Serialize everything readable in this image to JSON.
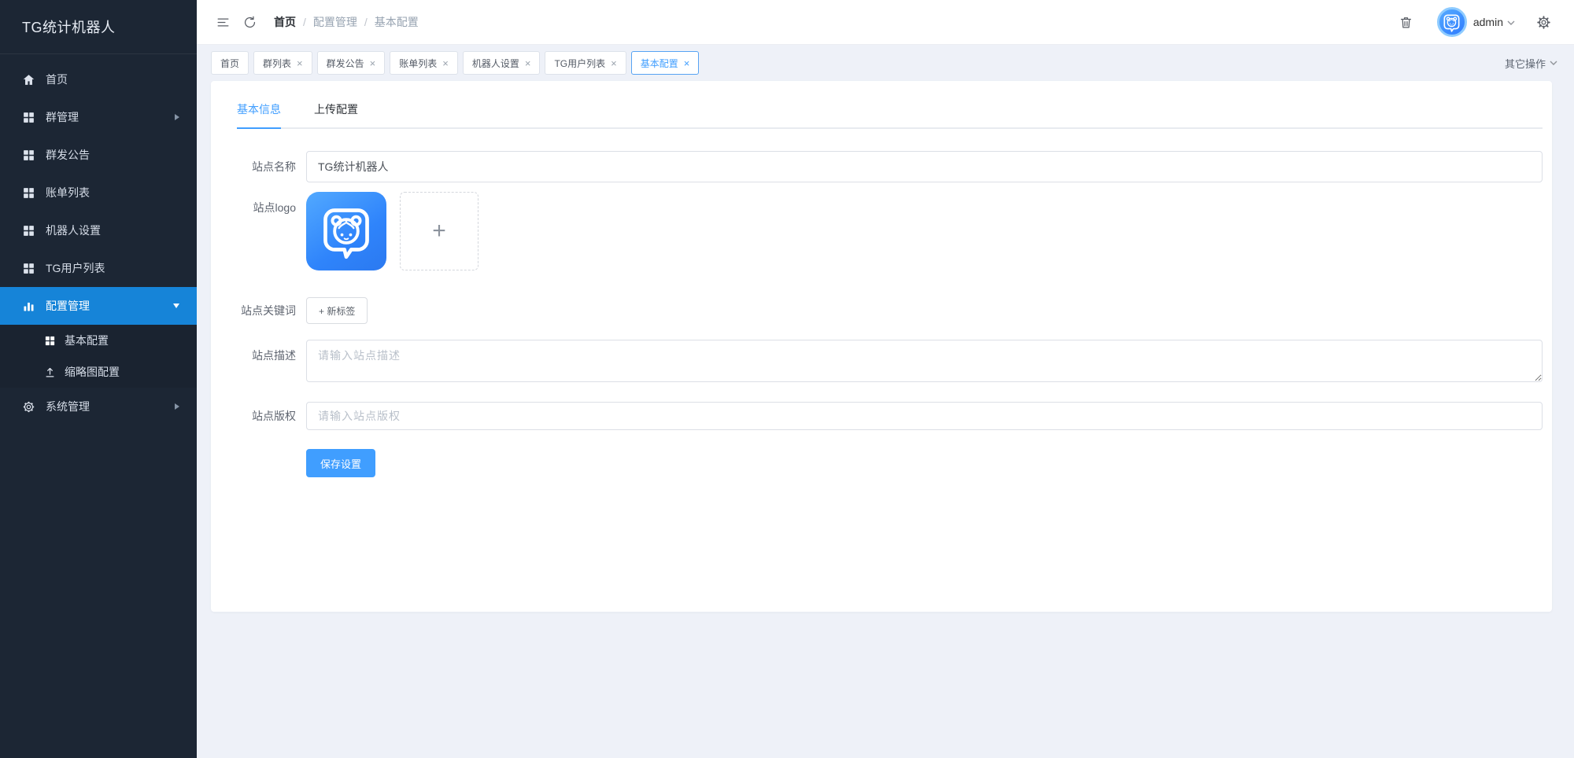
{
  "app": {
    "title": "TG统计机器人"
  },
  "glyphs": {
    "close": "×",
    "plus": "+",
    "slash": "/"
  },
  "sidebar": {
    "items": [
      {
        "label": "首页"
      },
      {
        "label": "群管理"
      },
      {
        "label": "群发公告"
      },
      {
        "label": "账单列表"
      },
      {
        "label": "机器人设置"
      },
      {
        "label": "TG用户列表"
      },
      {
        "label": "配置管理"
      },
      {
        "label": "系统管理"
      }
    ],
    "submenu": [
      {
        "label": "基本配置"
      },
      {
        "label": "缩略图配置"
      }
    ]
  },
  "header": {
    "breadcrumb": [
      "首页",
      "配置管理",
      "基本配置"
    ],
    "user": "admin"
  },
  "tagbar": {
    "tags": [
      {
        "label": "首页"
      },
      {
        "label": "群列表"
      },
      {
        "label": "群发公告"
      },
      {
        "label": "账单列表"
      },
      {
        "label": "机器人设置"
      },
      {
        "label": "TG用户列表"
      },
      {
        "label": "基本配置"
      }
    ],
    "more_label": "其它操作"
  },
  "content": {
    "tabs": [
      {
        "label": "基本信息"
      },
      {
        "label": "上传配置"
      }
    ],
    "form": {
      "site_name": {
        "label": "站点名称",
        "value": "TG统计机器人"
      },
      "site_logo": {
        "label": "站点logo"
      },
      "site_keywords": {
        "label": "站点关键词",
        "new_tag_label": "+ 新标签"
      },
      "site_desc": {
        "label": "站点描述",
        "placeholder": "请输入站点描述"
      },
      "site_copyright": {
        "label": "站点版权",
        "placeholder": "请输入站点版权"
      },
      "save_label": "保存设置"
    }
  },
  "colors": {
    "sidebar_bg": "#1c2634",
    "sidebar_active": "#1684d8",
    "accent_blue": "#409eff",
    "page_bg": "#eef1f8",
    "logo_gradient_start": "#52a9ff",
    "logo_gradient_end": "#2b79f0"
  }
}
